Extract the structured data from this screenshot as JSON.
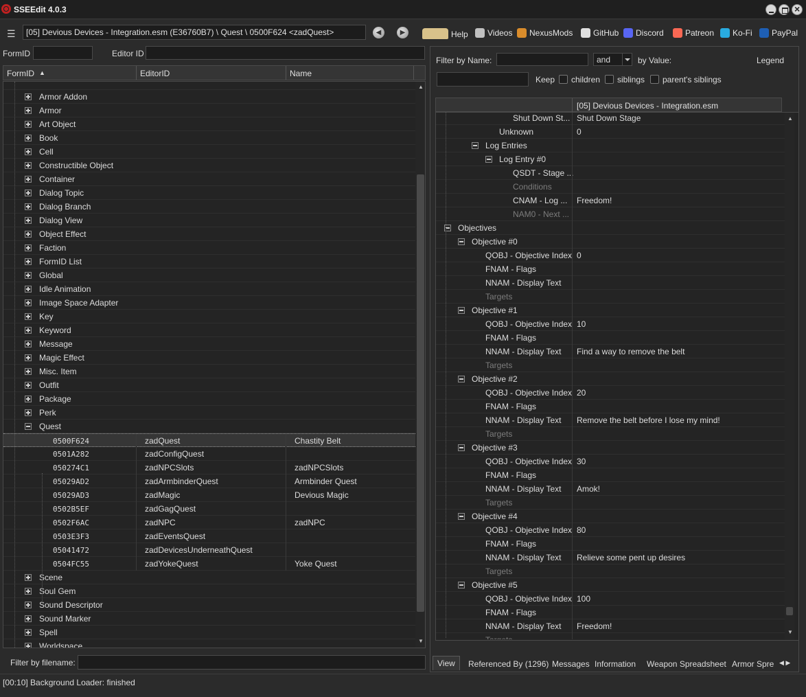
{
  "window": {
    "title": "SSEEdit 4.0.3"
  },
  "toolbar": {
    "path": "[05] Devious Devices - Integration.esm (E36760B7) \\ Quest \\ 0500F624 <zadQuest>",
    "links": [
      {
        "label": "Help",
        "icon": "book-icon",
        "color": "#d9c28a"
      },
      {
        "label": "Videos",
        "icon": "gp-icon",
        "color": "#c0c0c0"
      },
      {
        "label": "NexusMods",
        "icon": "nexus-icon",
        "color": "#d98c2b"
      },
      {
        "label": "GitHub",
        "icon": "github-icon",
        "color": "#e0e0e0"
      },
      {
        "label": "Discord",
        "icon": "discord-icon",
        "color": "#5865f2"
      },
      {
        "label": "Patreon",
        "icon": "patreon-icon",
        "color": "#f96854"
      },
      {
        "label": "Ko-Fi",
        "icon": "kofi-icon",
        "color": "#29abe0"
      },
      {
        "label": "PayPal",
        "icon": "paypal-icon",
        "color": "#1e5fb5"
      }
    ]
  },
  "left": {
    "formid_label": "FormID",
    "editorid_label": "Editor ID",
    "columns": [
      "FormID",
      "EditorID",
      "Name"
    ],
    "groups_top": [
      "Armor Addon",
      "Armor",
      "Art Object",
      "Book",
      "Cell",
      "Constructible Object",
      "Container",
      "Dialog Topic",
      "Dialog Branch",
      "Dialog View",
      "Object Effect",
      "Faction",
      "FormID List",
      "Global",
      "Idle Animation",
      "Image Space Adapter",
      "Key",
      "Keyword",
      "Message",
      "Magic Effect",
      "Misc. Item",
      "Outfit",
      "Package",
      "Perk"
    ],
    "quest_group": "Quest",
    "quests": [
      {
        "formid": "0500F624",
        "editorid": "zadQuest",
        "name": "Chastity Belt"
      },
      {
        "formid": "0501A282",
        "editorid": "zadConfigQuest",
        "name": ""
      },
      {
        "formid": "050274C1",
        "editorid": "zadNPCSlots",
        "name": "zadNPCSlots"
      },
      {
        "formid": "05029AD2",
        "editorid": "zadArmbinderQuest",
        "name": "Armbinder Quest"
      },
      {
        "formid": "05029AD3",
        "editorid": "zadMagic",
        "name": "Devious Magic"
      },
      {
        "formid": "0502B5EF",
        "editorid": "zadGagQuest",
        "name": ""
      },
      {
        "formid": "0502F6AC",
        "editorid": "zadNPC",
        "name": "zadNPC"
      },
      {
        "formid": "0503E3F3",
        "editorid": "zadEventsQuest",
        "name": ""
      },
      {
        "formid": "05041472",
        "editorid": "zadDevicesUnderneathQuest",
        "name": ""
      },
      {
        "formid": "0504FC55",
        "editorid": "zadYokeQuest",
        "name": "Yoke Quest"
      }
    ],
    "groups_bottom": [
      "Scene",
      "Soul Gem",
      "Sound Descriptor",
      "Sound Marker",
      "Spell",
      "Worldspace"
    ],
    "filename_label": "Filter by filename:"
  },
  "right": {
    "filter_name_label": "Filter by Name:",
    "combo_value": "and",
    "by_value_label": "by Value:",
    "legend_label": "Legend",
    "keep_label": "Keep",
    "check_children": "children",
    "check_siblings": "siblings",
    "check_parents": "parent's siblings",
    "column_header": "[05] Devious Devices - Integration.esm",
    "rows": [
      {
        "label": "Shut Down St...",
        "value": "Shut Down Stage",
        "dim": false,
        "exp": ""
      },
      {
        "label": "Unknown",
        "value": "0",
        "dim": false,
        "exp": ""
      },
      {
        "label": "Log Entries",
        "value": "",
        "dim": false,
        "exp": "minus"
      },
      {
        "label": "Log Entry #0",
        "value": "",
        "dim": false,
        "exp": "minus"
      },
      {
        "label": "QSDT - Stage ...",
        "value": "",
        "dim": false,
        "exp": ""
      },
      {
        "label": "Conditions",
        "value": "",
        "dim": true,
        "exp": ""
      },
      {
        "label": "CNAM - Log ...",
        "value": "Freedom!",
        "dim": false,
        "exp": ""
      },
      {
        "label": "NAM0 - Next ...",
        "value": "",
        "dim": true,
        "exp": ""
      },
      {
        "label": "Objectives",
        "value": "",
        "dim": false,
        "exp": "minus"
      },
      {
        "label": "Objective #0",
        "value": "",
        "dim": false,
        "exp": "minus"
      },
      {
        "label": "QOBJ - Objective Index",
        "value": "0",
        "dim": false,
        "exp": ""
      },
      {
        "label": "FNAM - Flags",
        "value": "",
        "dim": false,
        "exp": ""
      },
      {
        "label": "NNAM - Display Text",
        "value": "",
        "dim": false,
        "exp": ""
      },
      {
        "label": "Targets",
        "value": "",
        "dim": true,
        "exp": ""
      },
      {
        "label": "Objective #1",
        "value": "",
        "dim": false,
        "exp": "minus"
      },
      {
        "label": "QOBJ - Objective Index",
        "value": "10",
        "dim": false,
        "exp": ""
      },
      {
        "label": "FNAM - Flags",
        "value": "",
        "dim": false,
        "exp": ""
      },
      {
        "label": "NNAM - Display Text",
        "value": "Find a way to remove the belt",
        "dim": false,
        "exp": ""
      },
      {
        "label": "Targets",
        "value": "",
        "dim": true,
        "exp": ""
      },
      {
        "label": "Objective #2",
        "value": "",
        "dim": false,
        "exp": "minus"
      },
      {
        "label": "QOBJ - Objective Index",
        "value": "20",
        "dim": false,
        "exp": ""
      },
      {
        "label": "FNAM - Flags",
        "value": "",
        "dim": false,
        "exp": ""
      },
      {
        "label": "NNAM - Display Text",
        "value": "Remove the belt before I lose my mind!",
        "dim": false,
        "exp": ""
      },
      {
        "label": "Targets",
        "value": "",
        "dim": true,
        "exp": ""
      },
      {
        "label": "Objective #3",
        "value": "",
        "dim": false,
        "exp": "minus"
      },
      {
        "label": "QOBJ - Objective Index",
        "value": "30",
        "dim": false,
        "exp": ""
      },
      {
        "label": "FNAM - Flags",
        "value": "",
        "dim": false,
        "exp": ""
      },
      {
        "label": "NNAM - Display Text",
        "value": "Amok!",
        "dim": false,
        "exp": ""
      },
      {
        "label": "Targets",
        "value": "",
        "dim": true,
        "exp": ""
      },
      {
        "label": "Objective #4",
        "value": "",
        "dim": false,
        "exp": "minus"
      },
      {
        "label": "QOBJ - Objective Index",
        "value": "80",
        "dim": false,
        "exp": ""
      },
      {
        "label": "FNAM - Flags",
        "value": "",
        "dim": false,
        "exp": ""
      },
      {
        "label": "NNAM - Display Text",
        "value": "Relieve some pent up desires",
        "dim": false,
        "exp": ""
      },
      {
        "label": "Targets",
        "value": "",
        "dim": true,
        "exp": ""
      },
      {
        "label": "Objective #5",
        "value": "",
        "dim": false,
        "exp": "minus"
      },
      {
        "label": "QOBJ - Objective Index",
        "value": "100",
        "dim": false,
        "exp": ""
      },
      {
        "label": "FNAM - Flags",
        "value": "",
        "dim": false,
        "exp": ""
      },
      {
        "label": "NNAM - Display Text",
        "value": "Freedom!",
        "dim": false,
        "exp": ""
      },
      {
        "label": "Targets",
        "value": "",
        "dim": true,
        "exp": ""
      }
    ],
    "tabs": [
      "View",
      "Referenced By (1296)",
      "Messages",
      "Information",
      "Weapon Spreadsheet",
      "Armor Spre"
    ]
  },
  "status": {
    "text": "[00:10] Background Loader: finished"
  }
}
